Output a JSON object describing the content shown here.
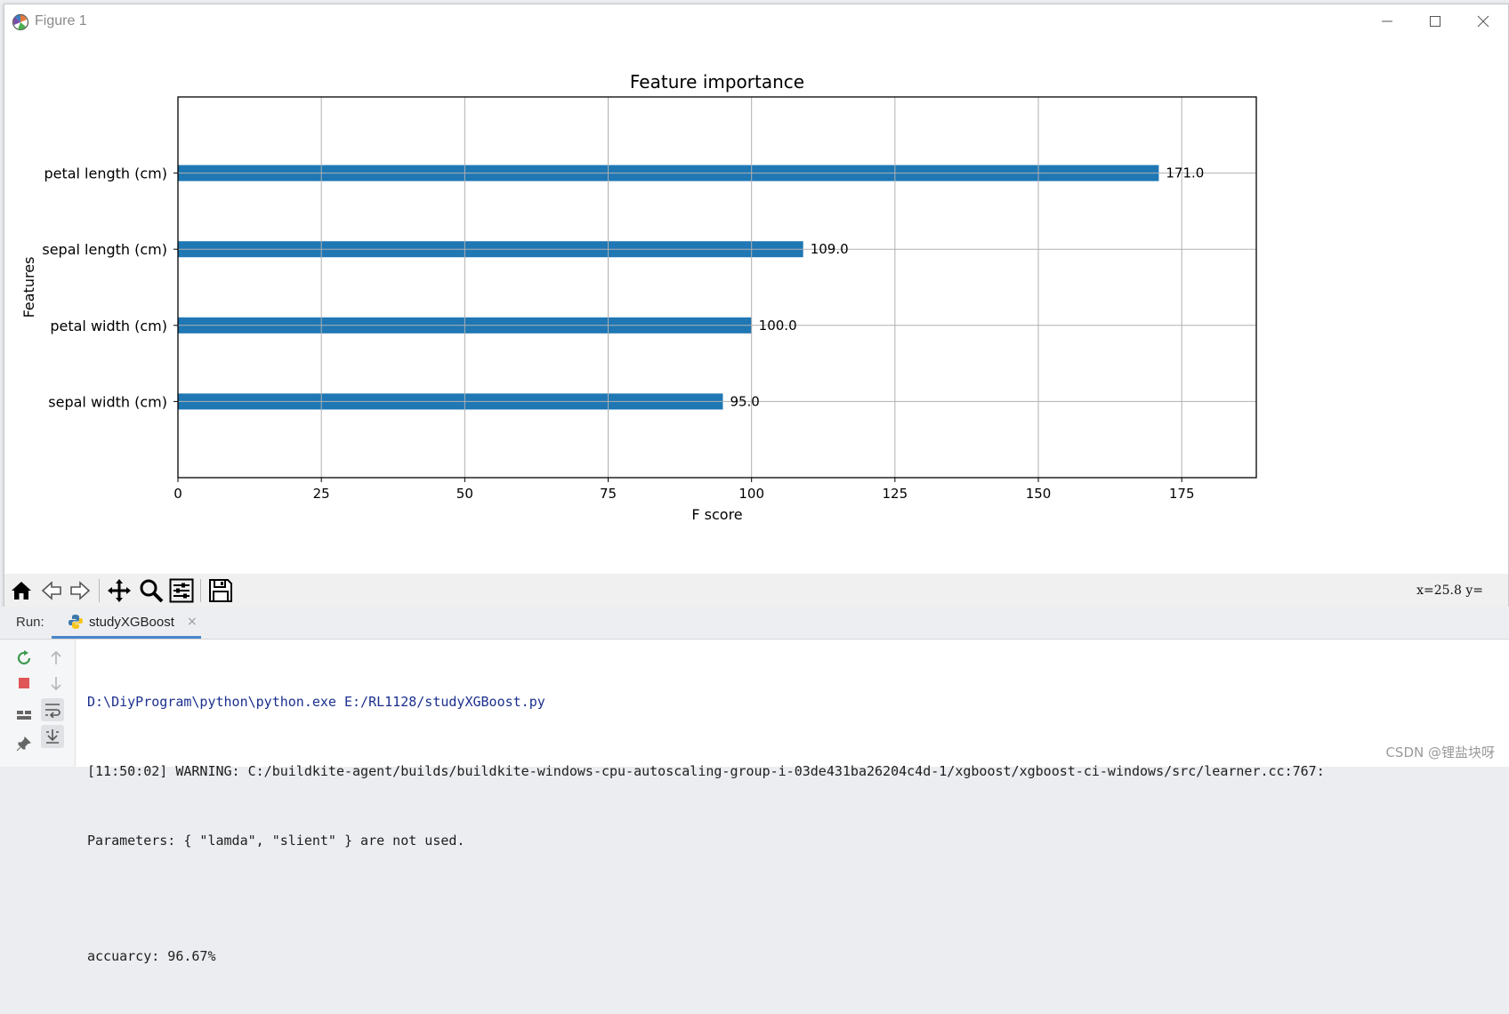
{
  "window": {
    "title": "Figure 1"
  },
  "chart_data": {
    "type": "bar",
    "orientation": "horizontal",
    "title": "Feature importance",
    "xlabel": "F score",
    "ylabel": "Features",
    "categories": [
      "petal length (cm)",
      "sepal length (cm)",
      "petal width (cm)",
      "sepal width (cm)"
    ],
    "values": [
      171.0,
      109.0,
      100.0,
      95.0
    ],
    "value_labels": [
      "171.0",
      "109.0",
      "100.0",
      "95.0"
    ],
    "xlim": [
      0,
      188
    ],
    "xticks": [
      0,
      25,
      50,
      75,
      100,
      125,
      150,
      175
    ],
    "grid": true,
    "bar_color": "#1f77b4"
  },
  "toolbar": {
    "buttons": [
      "home-icon",
      "back-icon",
      "forward-icon",
      "pan-icon",
      "zoom-icon",
      "configure-icon",
      "save-icon"
    ],
    "coords": "x=25.8 y="
  },
  "run_panel": {
    "label": "Run:",
    "tab_label": "studyXGBoost",
    "close_glyph": "×",
    "lines": [
      "D:\\DiyProgram\\python\\python.exe E:/RL1128/studyXGBoost.py",
      "[11:50:02] WARNING: C:/buildkite-agent/builds/buildkite-windows-cpu-autoscaling-group-i-03de431ba26204c4d-1/xgboost/xgboost-ci-windows/src/learner.cc:767:",
      "Parameters: { \"lamda\", \"slient\" } are not used.",
      "",
      "accuarcy: 96.67%"
    ]
  },
  "watermark": "CSDN @锂盐块呀"
}
